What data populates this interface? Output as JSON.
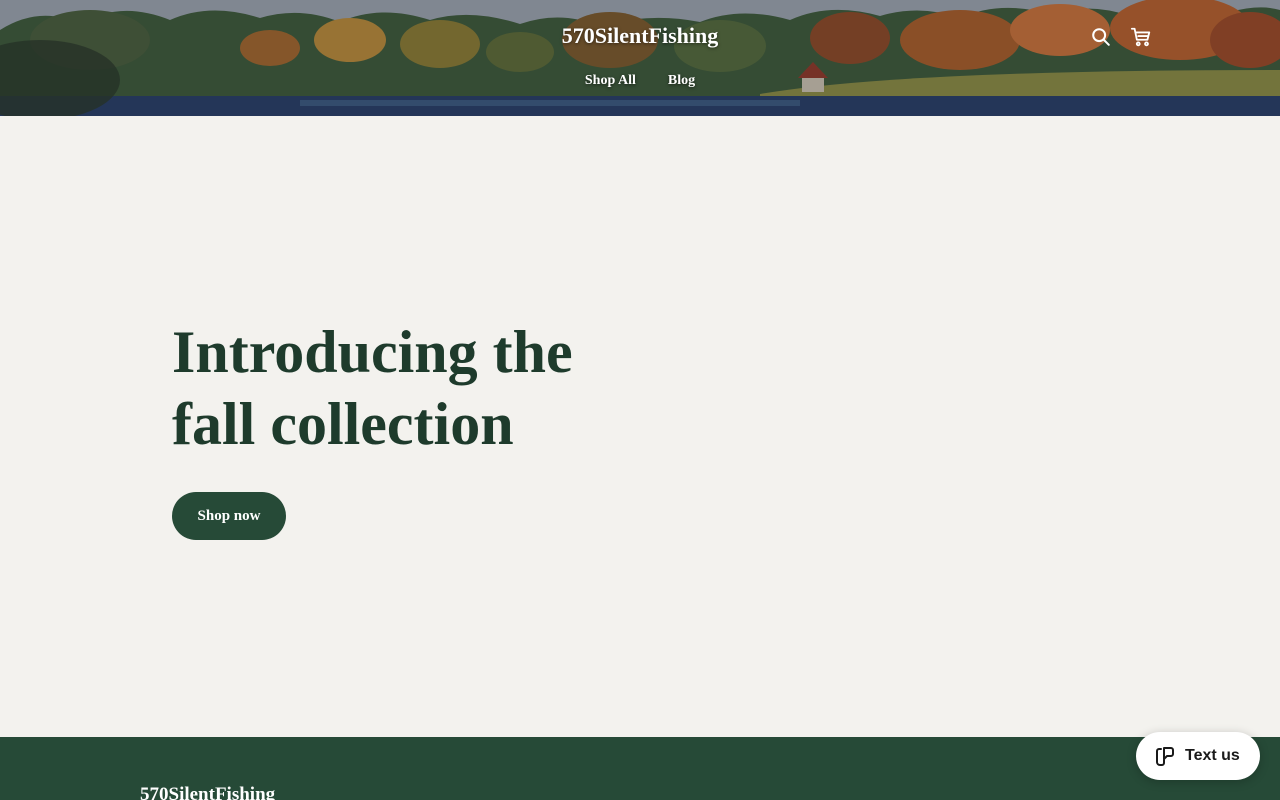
{
  "header": {
    "site_title": "570SilentFishing",
    "nav": [
      {
        "label": "Shop All"
      },
      {
        "label": "Blog"
      }
    ],
    "icons": [
      "search-icon",
      "cart-icon"
    ]
  },
  "hero": {
    "heading_lines": [
      "Introducing the",
      "fall collection"
    ],
    "cta_label": "Shop now"
  },
  "footer": {
    "site_title": "570SilentFishing"
  },
  "chat_widget": {
    "label": "Text us",
    "icon": "chat-icon"
  },
  "colors": {
    "page_background": "#f3f2ee",
    "accent_green": "#264a37",
    "heading_green": "#1e3b2c",
    "header_text": "#ffffff"
  }
}
